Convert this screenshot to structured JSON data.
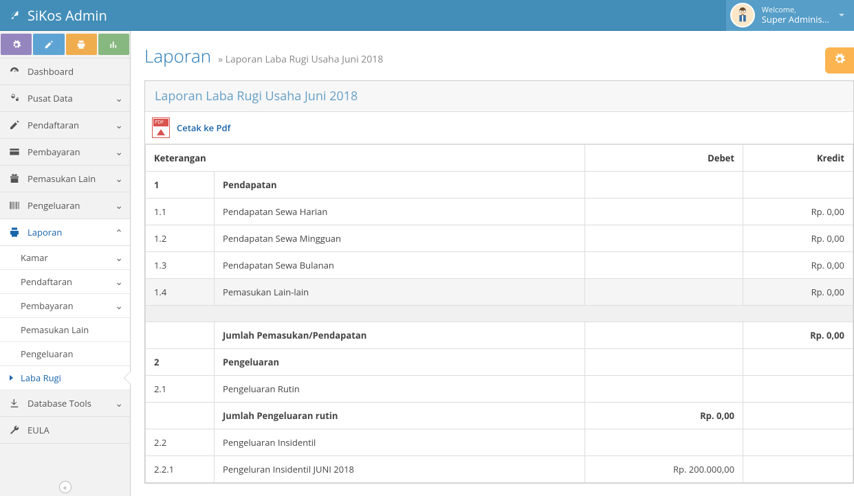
{
  "brand": {
    "title": "SiKos Admin"
  },
  "user": {
    "welcome": "Welcome,",
    "name": "Super Adminis..."
  },
  "sidebar": {
    "items": [
      {
        "name": "dashboard",
        "label": "Dashboard",
        "icon": "dashboard"
      },
      {
        "name": "pusat-data",
        "label": "Pusat Data",
        "icon": "cogs",
        "expandable": true
      },
      {
        "name": "pendaftaran",
        "label": "Pendaftaran",
        "icon": "edit",
        "expandable": true
      },
      {
        "name": "pembayaran",
        "label": "Pembayaran",
        "icon": "credit-card",
        "expandable": true
      },
      {
        "name": "pemasukan-lain",
        "label": "Pemasukan Lain",
        "icon": "gift",
        "expandable": true
      },
      {
        "name": "pengeluaran",
        "label": "Pengeluaran",
        "icon": "barcode",
        "expandable": true
      },
      {
        "name": "laporan",
        "label": "Laporan",
        "icon": "print",
        "expandable": true,
        "open": true,
        "children": [
          {
            "name": "kamar",
            "label": "Kamar",
            "expandable": true
          },
          {
            "name": "pendaftaran",
            "label": "Pendaftaran",
            "expandable": true
          },
          {
            "name": "pembayaran",
            "label": "Pembayaran",
            "expandable": true
          },
          {
            "name": "pemasukan-lain",
            "label": "Pemasukan Lain"
          },
          {
            "name": "pengeluaran",
            "label": "Pengeluaran"
          },
          {
            "name": "laba-rugi",
            "label": "Laba Rugi",
            "active": true
          }
        ]
      },
      {
        "name": "database-tools",
        "label": "Database Tools",
        "icon": "download",
        "expandable": true
      },
      {
        "name": "eula",
        "label": "EULA",
        "icon": "wrench"
      }
    ]
  },
  "page": {
    "title": "Laporan",
    "subtitle_prefix": "» ",
    "subtitle": "Laporan Laba Rugi Usaha Juni 2018"
  },
  "panel": {
    "title": "Laporan Laba Rugi Usaha Juni 2018",
    "pdf_label": "Cetak ke Pdf"
  },
  "table": {
    "headers": {
      "keterangan": "Keterangan",
      "debet": "Debet",
      "kredit": "Kredit"
    },
    "rows": [
      {
        "num": "1",
        "label": "Pendapatan",
        "section": true
      },
      {
        "num": "1.1",
        "label": "Pendapatan Sewa Harian",
        "kredit": "Rp. 0,00"
      },
      {
        "num": "1.2",
        "label": "Pendapatan Sewa Mingguan",
        "kredit": "Rp. 0,00"
      },
      {
        "num": "1.3",
        "label": "Pendapatan Sewa Bulanan",
        "kredit": "Rp. 0,00"
      },
      {
        "num": "1.4",
        "label": "Pemasukan Lain-lain",
        "kredit": "Rp. 0,00",
        "shade": true
      },
      {
        "spacer": true
      },
      {
        "num": "",
        "label": "Jumlah Pemasukan/Pendapatan",
        "kredit": "Rp. 0,00",
        "bold": true
      },
      {
        "num": "2",
        "label": "Pengeluaran",
        "section": true
      },
      {
        "num": "2.1",
        "label": "Pengeluaran Rutin"
      },
      {
        "num": "",
        "label": "Jumlah Pengeluaran rutin",
        "debet": "Rp. 0,00",
        "bold": true
      },
      {
        "num": "2.2",
        "label": "Pengeluaran Insidentil"
      },
      {
        "num": "2.2.1",
        "label": "Pengeluran Insidentil JUNI 2018",
        "debet": "Rp. 200.000,00"
      }
    ]
  }
}
